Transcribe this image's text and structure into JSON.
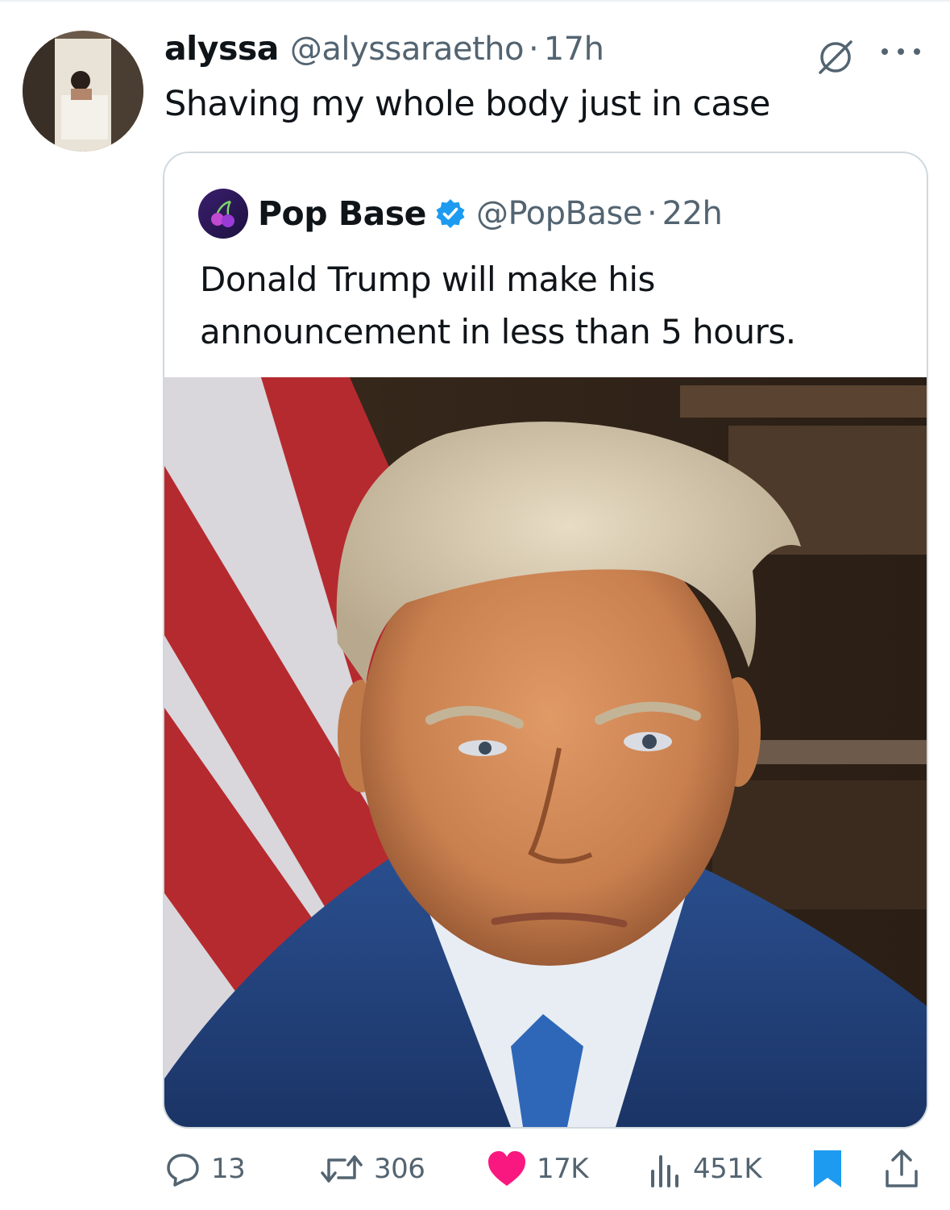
{
  "tweet": {
    "author_name": "alyssa",
    "handle": "@alyssaraetho",
    "separator": "·",
    "time": "17h",
    "text": "Shaving my whole body just in case"
  },
  "quoted_tweet": {
    "author_name": "Pop Base",
    "handle": "@PopBase",
    "separator": "·",
    "time": "22h",
    "text": "Donald Trump will make his announcement in less than 5 hours.",
    "image_alt": "portrait photo"
  },
  "actions": {
    "replies": "13",
    "reposts": "306",
    "likes": "17K",
    "views": "451K"
  },
  "icons": {
    "grok": "grok-icon",
    "more": "more-icon",
    "verified": "verified-badge-icon",
    "reply": "reply-icon",
    "repost": "repost-icon",
    "like": "heart-icon",
    "views": "views-icon",
    "bookmark": "bookmark-icon",
    "share": "share-icon"
  },
  "colors": {
    "like": "#f91880",
    "verified": "#1d9bf0",
    "bookmark": "#1d9bf0",
    "muted": "#536471"
  }
}
